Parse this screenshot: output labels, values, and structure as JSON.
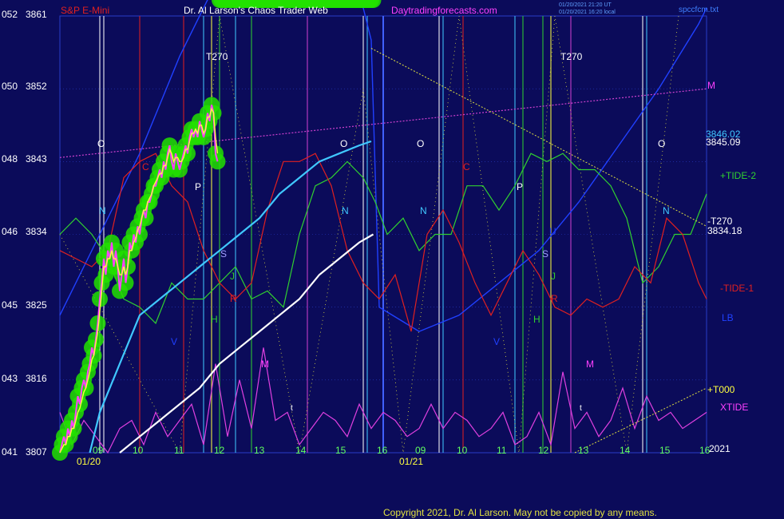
{
  "header": {
    "instrument": "S&P E-Mini",
    "author": "Dr. Al Larson's Chaos Trader Web",
    "site": "Daytradingforecasts.com",
    "stamp1": "01/20/2021 21:20 UT",
    "stamp2": "01/20/2021 16:20 local",
    "file": "spccfcm.txt"
  },
  "colors": {
    "background": "#0b0b5a",
    "grid": "#2a3cc8",
    "price": "#ff40ff",
    "price_fast_avg": "#ffff40",
    "price_halo": "#22e000",
    "slow_avg": "#40c8ff",
    "white_line": "#ffffff",
    "tide_plus": "#30d030",
    "tide_minus": "#e02020",
    "lb": "#2040ff",
    "xtide": "#e040e0",
    "t270_trend": "#e0e040",
    "m_line": "#d040d0",
    "markers": "#ffffff"
  },
  "footer": {
    "copyright": "Copyright 2021, Dr. Al Larson. May not be copied by any means."
  },
  "chart_data": {
    "type": "line",
    "y_axis": {
      "left_labels": [
        "052",
        "050",
        "048",
        "046",
        "045",
        "043",
        "041"
      ],
      "right_labels": [
        "3861",
        "3852",
        "3843",
        "3834",
        "3825",
        "3816",
        "3807"
      ],
      "ylim": [
        3807,
        3861
      ]
    },
    "x_axis": {
      "day1_hours": [
        "09",
        "10",
        "11",
        "12",
        "13",
        "14",
        "15",
        "16"
      ],
      "day2_hours": [
        "09",
        "10",
        "11",
        "12",
        "13",
        "14",
        "15",
        "16"
      ],
      "dates": [
        "01/20",
        "01/21"
      ],
      "year": "2021"
    },
    "price_series": {
      "name": "S&P E-Mini",
      "t": [
        0,
        0.5,
        1,
        1.5,
        2,
        2.5,
        3,
        3.5,
        4,
        4.5,
        5,
        5.5,
        6,
        6.5,
        7,
        7.5,
        8,
        8.5,
        9,
        9.5,
        10,
        10.5,
        11,
        11.5,
        12,
        12.5,
        13,
        13.5,
        14,
        14.5,
        15,
        15.5,
        16,
        16.5,
        17,
        17.5,
        18,
        18.5,
        19,
        19.5,
        20,
        20.5,
        21,
        21.5,
        22,
        22.5,
        23,
        23.5,
        24,
        24.5,
        25,
        25.5,
        26,
        26.5,
        27,
        27.5,
        28,
        28.5,
        29,
        29.5,
        30,
        30.5,
        31,
        31.5,
        32,
        32.5,
        33,
        33.5,
        34,
        34.5,
        35,
        35.5,
        36,
        36.5,
        37,
        37.5,
        38,
        38.5,
        39,
        39.5,
        40,
        40.5,
        41,
        41.5,
        42,
        42.5,
        43,
        43.5,
        44,
        44.5,
        45,
        45.5,
        46,
        46.5,
        47,
        47.5,
        48,
        48.5,
        49,
        49.5,
        50,
        50.5,
        51,
        51.5,
        52,
        52.5,
        53,
        53.5,
        54,
        54.5,
        55,
        55.5,
        56,
        56.5,
        57,
        57.5,
        58,
        58.5,
        59,
        59.5,
        60,
        60.5,
        61,
        61.5,
        62,
        62.5,
        63,
        63.5,
        64,
        64.5,
        65,
        65.5,
        66,
        66.5,
        67,
        67.5,
        68,
        68.5,
        69,
        69.5,
        70,
        70.5,
        71,
        71.5,
        72,
        72.5,
        73,
        73.5,
        74,
        74.5,
        75,
        75.5,
        76,
        76.5,
        77,
        77.5,
        78,
        78.5
      ],
      "values": [
        3807,
        3808,
        3809,
        3808,
        3810,
        3809,
        3811,
        3810,
        3812,
        3814,
        3813,
        3815,
        3816,
        3815,
        3817,
        3818,
        3820,
        3819,
        3821,
        3823,
        3826,
        3828,
        3831,
        3829,
        3832,
        3831,
        3833,
        3830,
        3832,
        3830,
        3827,
        3829,
        3831,
        3828,
        3830,
        3833,
        3832,
        3834,
        3833,
        3835,
        3834,
        3836,
        3837,
        3836,
        3838,
        3838,
        3839,
        3840,
        3840,
        3841,
        3842,
        3841,
        3843,
        3842,
        3844,
        3845,
        3843,
        3842,
        3844,
        3843,
        3842,
        3843,
        3844,
        3845,
        3844,
        3846,
        3847,
        3846,
        3847,
        3846,
        3848,
        3847,
        3846,
        3847,
        3849,
        3848,
        3850,
        3849,
        3844,
        3843
      ],
      "fast_average": [
        3807,
        3807.5,
        3808,
        3808,
        3809,
        3809,
        3810,
        3810,
        3811,
        3812,
        3812.5,
        3813.5,
        3814.5,
        3815,
        3816,
        3817,
        3818.5,
        3819,
        3820.5,
        3822,
        3824.5,
        3827,
        3830,
        3830,
        3831,
        3831,
        3832,
        3831,
        3831,
        3830,
        3829,
        3829,
        3830,
        3829,
        3830,
        3832,
        3832,
        3833,
        3833.5,
        3834.5,
        3835,
        3836,
        3837,
        3837,
        3838,
        3838.5,
        3839,
        3840,
        3840.5,
        3841,
        3841.5,
        3841.5,
        3842.5,
        3842.5,
        3843.5,
        3844.5,
        3844,
        3843,
        3843.5,
        3843.5,
        3843,
        3843,
        3843.5,
        3844.5,
        3844.5,
        3845.5,
        3846.5,
        3846.5,
        3847,
        3846.5,
        3847.5,
        3847.5,
        3846.5,
        3847,
        3848.5,
        3848.5,
        3849.5,
        3849,
        3846,
        3844
      ]
    },
    "slow_average": {
      "t": [
        7.5,
        10,
        15,
        20,
        25,
        30,
        35,
        40,
        45,
        50,
        55,
        60,
        65,
        70,
        75,
        78
      ],
      "values": [
        3807,
        3812,
        3818,
        3824,
        3826,
        3828,
        3830,
        3832,
        3834,
        3836,
        3839,
        3841,
        3843,
        3844,
        3845,
        3845.5
      ]
    },
    "white_line": {
      "t": [
        15,
        20,
        25,
        30,
        35,
        40,
        45,
        50,
        55,
        60,
        65,
        70,
        75,
        78.5
      ],
      "values": [
        3807,
        3809,
        3811,
        3813,
        3815,
        3818,
        3820,
        3822,
        3824,
        3826,
        3829,
        3831,
        3833,
        3834
      ]
    },
    "plus_tide": {
      "name": "+TIDE-2",
      "t": [
        0,
        4,
        8,
        12,
        16,
        20,
        24,
        28,
        32,
        36,
        40,
        44,
        48,
        52,
        56,
        60,
        64,
        68,
        72,
        76,
        79,
        82,
        86,
        90,
        94,
        98,
        102,
        106,
        110,
        114,
        118,
        122,
        126,
        130,
        134,
        138,
        142,
        146,
        150,
        154,
        158,
        162
      ],
      "values": [
        3834,
        3836,
        3834,
        3831,
        3826,
        3825,
        3823,
        3828,
        3826,
        3826,
        3828,
        3830,
        3826,
        3827,
        3825,
        3834,
        3840,
        3841,
        3843,
        3841,
        3838,
        3834,
        3836,
        3832,
        3834,
        3834,
        3840,
        3840,
        3837,
        3840,
        3844,
        3843,
        3844,
        3842,
        3842,
        3840,
        3836,
        3828,
        3830,
        3834,
        3834,
        3839
      ]
    },
    "minus_tide": {
      "name": "-TIDE-1",
      "t": [
        0,
        4,
        8,
        12,
        16,
        20,
        24,
        28,
        32,
        36,
        40,
        44,
        48,
        52,
        56,
        60,
        64,
        68,
        72,
        76,
        80,
        84,
        88,
        92,
        96,
        100,
        104,
        108,
        112,
        116,
        120,
        124,
        128,
        132,
        136,
        140,
        144,
        148,
        152,
        156,
        160,
        162
      ],
      "values": [
        3832,
        3831,
        3830,
        3832,
        3841,
        3843,
        3844,
        3840,
        3838,
        3832,
        3828,
        3826,
        3828,
        3837,
        3843,
        3843,
        3844,
        3840,
        3832,
        3828,
        3826,
        3829,
        3822,
        3834,
        3837,
        3833,
        3828,
        3824,
        3828,
        3832,
        3829,
        3825,
        3824,
        3826,
        3825,
        3826,
        3830,
        3828,
        3836,
        3834,
        3828,
        3826
      ]
    },
    "lb": {
      "name": "LB",
      "t": [
        0,
        10,
        20,
        30,
        40,
        50,
        60,
        70,
        76,
        78,
        80,
        90,
        100,
        110,
        120,
        130,
        140,
        150,
        160,
        162
      ],
      "values": [
        3824,
        3834,
        3844,
        3856,
        3866,
        3870,
        3870,
        3866,
        3862,
        3858,
        3825,
        3822,
        3824,
        3828,
        3832,
        3838,
        3845,
        3852,
        3860,
        3862
      ]
    },
    "xtide": {
      "name": "XTIDE",
      "t": [
        0,
        3,
        6,
        9,
        12,
        15,
        18,
        21,
        24,
        27,
        30,
        33,
        36,
        39,
        42,
        45,
        48,
        51,
        54,
        57,
        60,
        63,
        66,
        69,
        72,
        75,
        78,
        81,
        84,
        87,
        90,
        93,
        96,
        99,
        102,
        105,
        108,
        111,
        114,
        117,
        120,
        123,
        126,
        129,
        132,
        135,
        138,
        141,
        144,
        147,
        150,
        153,
        156,
        159,
        162
      ],
      "values": [
        3812,
        3808,
        3811,
        3809,
        3807,
        3810,
        3811,
        3808,
        3812,
        3809,
        3811,
        3813,
        3808,
        3818,
        3809,
        3816,
        3810,
        3820,
        3811,
        3812,
        3808,
        3810,
        3812,
        3811,
        3809,
        3813,
        3810,
        3812,
        3811,
        3809,
        3810,
        3813,
        3810,
        3812,
        3811,
        3809,
        3810,
        3812,
        3808,
        3809,
        3812,
        3808,
        3817,
        3810,
        3812,
        3809,
        3811,
        3815,
        3810,
        3814,
        3811,
        3812,
        3810,
        3811,
        3812
      ]
    },
    "m_line": {
      "name": "M",
      "t": [
        0,
        162
      ],
      "values": [
        3843.5,
        3852
      ]
    },
    "t270_line": {
      "name": "-T270",
      "t": [
        78,
        162
      ],
      "values": [
        3857,
        3835
      ]
    },
    "t000_line": {
      "name": "+T000",
      "t": [
        129,
        162
      ],
      "values": [
        3807,
        3815
      ]
    },
    "right_labels": {
      "m": "M",
      "v1": "3846.02",
      "v2": "3845.09",
      "plus_tide": "+TIDE-2",
      "minus_t270": "-T270",
      "v3": "3834.18",
      "minus_tide": "-TIDE-1",
      "lb": "LB",
      "plus_t000": "+T000",
      "xtide": "XTIDE"
    },
    "markers": {
      "O": "O",
      "N": "N",
      "C": "C",
      "P": "P",
      "S": "S",
      "J": "J",
      "R": "R",
      "H": "H",
      "V": "V",
      "M": "M",
      "t": "t",
      "U": "U",
      "T270": "T270"
    }
  }
}
